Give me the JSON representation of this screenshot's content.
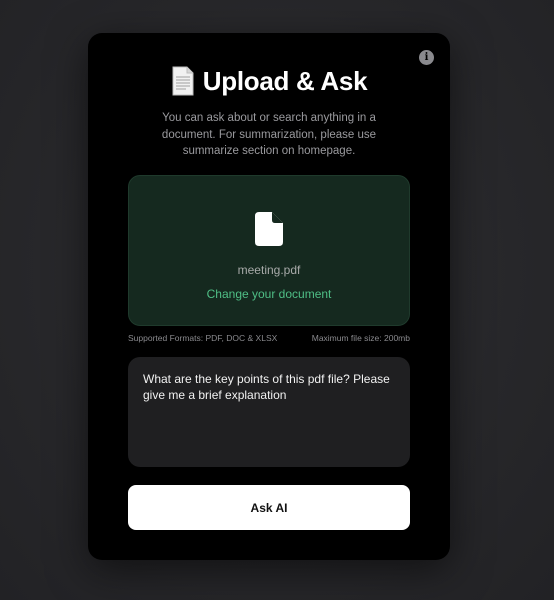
{
  "dialog": {
    "title": "Upload & Ask",
    "title_icon": "page-emoji-icon",
    "info_icon": "info-icon",
    "subtitle": "You can ask about or search anything in a document. For summarization, please use summarize section on homepage."
  },
  "upload": {
    "file_icon": "file-icon",
    "file_name": "meeting.pdf",
    "change_label": "Change your document",
    "supported_formats": "Supported Formats: PDF, DOC & XLSX",
    "max_size": "Maximum file size: 200mb"
  },
  "question": {
    "value": "What are the key points of this pdf file? Please give me a brief explanation"
  },
  "actions": {
    "ask_label": "Ask AI"
  },
  "colors": {
    "upload_bg": "#15291f",
    "accent_green": "#4fbf86",
    "card_bg": "#000000",
    "input_bg": "#1f1f21"
  }
}
